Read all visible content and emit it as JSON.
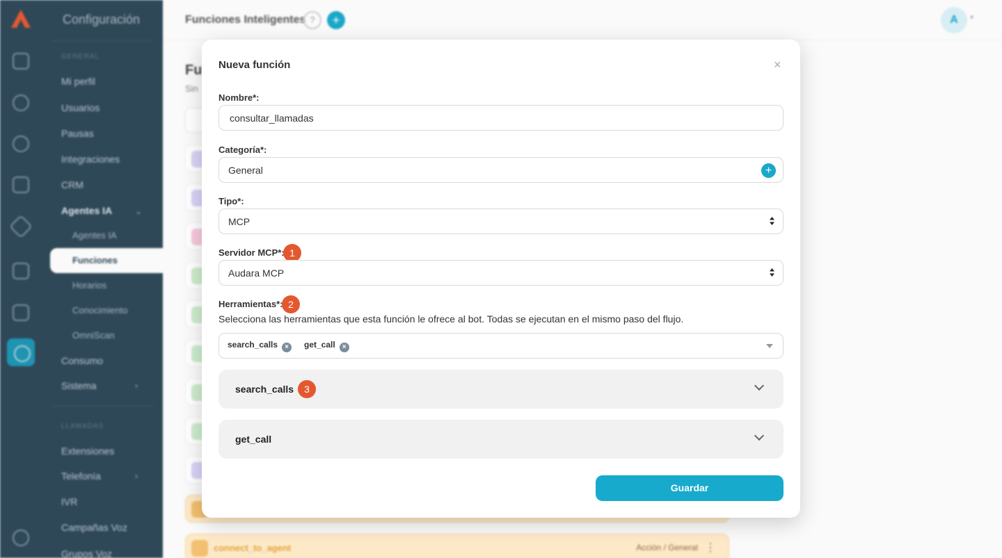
{
  "background": {
    "sidebar": {
      "title": "Configuración",
      "group_general": "GENERAL",
      "group_llamadas": "LLAMADAS",
      "items": [
        "Mi perfil",
        "Usuarios",
        "Pausas",
        "Integraciones",
        "CRM"
      ],
      "agentes_ia": "Agentes IA",
      "sub_items": [
        "Agentes IA",
        "Funciones",
        "Horarios",
        "Conocimiento",
        "OmniScan"
      ],
      "items_after": [
        "Consumo",
        "Sistema"
      ],
      "items_llamadas": [
        "Extensiones",
        "Telefonía",
        "IVR",
        "Campañas Voz",
        "Grupos Voz"
      ]
    },
    "header": {
      "title": "Funciones Inteligentes",
      "help": "?",
      "avatar": "A"
    },
    "content": {
      "heading": "Fu",
      "subheading": "Sin",
      "last_row_label": "connect_to_agent",
      "last_row_meta": "Acción / General"
    }
  },
  "modal": {
    "title": "Nueva función",
    "close": "×",
    "nombre": {
      "label": "Nombre*:",
      "value": "consultar_llamadas"
    },
    "categoria": {
      "label": "Categoría*:",
      "value": "General"
    },
    "tipo": {
      "label": "Tipo*:",
      "value": "MCP"
    },
    "servidor": {
      "label": "Servidor MCP*:",
      "value": "Audara MCP",
      "badge": "1"
    },
    "herramientas": {
      "label": "Herramientas*:",
      "badge": "2",
      "help": "Selecciona las herramientas que esta función le ofrece al bot. Todas se ejecutan en el mismo paso del flujo.",
      "tags": [
        "search_calls",
        "get_call"
      ]
    },
    "accordions": [
      {
        "title": "search_calls",
        "badge": "3"
      },
      {
        "title": "get_call"
      }
    ],
    "save": "Guardar"
  },
  "colors": {
    "accent": "#17aacd",
    "badge": "#e4582f",
    "sidebar": "#2f4858"
  }
}
